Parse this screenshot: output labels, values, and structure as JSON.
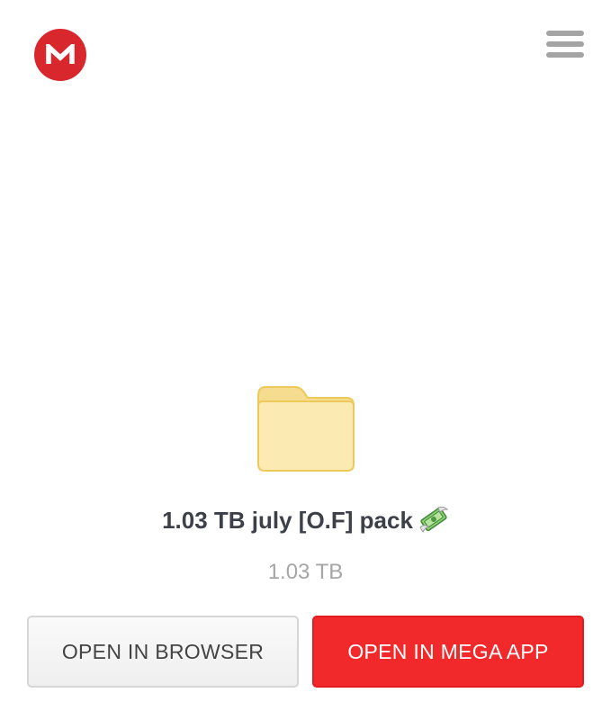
{
  "header": {
    "logo_icon": "mega-logo-icon",
    "logo_letter": "M",
    "menu_icon": "hamburger-menu-icon"
  },
  "file": {
    "icon": "folder-icon",
    "name": "1.03 TB july [O.F] pack",
    "name_emoji_icon": "money-with-wings-icon",
    "size": "1.03 TB"
  },
  "actions": {
    "open_in_browser_label": "OPEN IN BROWSER",
    "open_in_app_label": "OPEN IN MEGA APP"
  },
  "colors": {
    "brand_red": "#d9272e",
    "primary_button": "#f2292b",
    "folder_fill": "#fbeab1",
    "folder_tab": "#f6dc8e",
    "folder_stroke": "#ecc95a",
    "title_text": "#3c4048",
    "muted_text": "#a6a6a6"
  }
}
